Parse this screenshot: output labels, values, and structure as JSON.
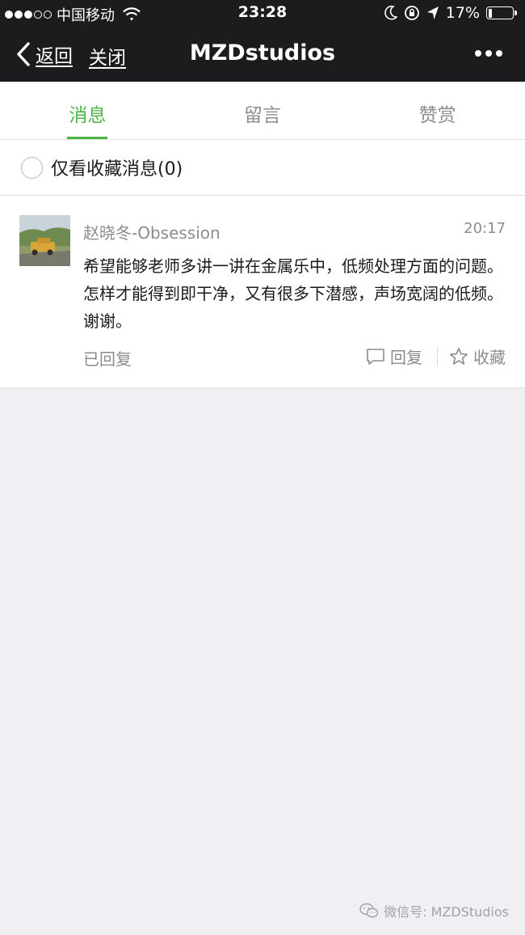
{
  "status_bar": {
    "carrier": "中国移动",
    "time": "23:28",
    "battery": "17%",
    "battery_level": 0.17
  },
  "nav": {
    "back_label": "返回",
    "close_label": "关闭",
    "title": "MZDstudios",
    "more_icon": "more-dots-icon"
  },
  "tabs": [
    {
      "label": "消息",
      "active": true
    },
    {
      "label": "留言",
      "active": false
    },
    {
      "label": "赞赏",
      "active": false
    }
  ],
  "filter": {
    "label": "仅看收藏消息(0)",
    "checked": false
  },
  "message": {
    "author": "赵晓冬-Obsession",
    "time": "20:17",
    "body": "希望能够老师多讲一讲在金属乐中，低频处理方面的问题。怎样才能得到即干净，又有很多下潜感，声场宽阔的低频。谢谢。",
    "status": "已回复",
    "reply_label": "回复",
    "favorite_label": "收藏"
  },
  "watermark": {
    "text": "微信号: MZDStudios"
  },
  "colors": {
    "accent": "#4cb548",
    "bar_bg": "#1c1c1e",
    "page_bg": "#efeff4"
  }
}
